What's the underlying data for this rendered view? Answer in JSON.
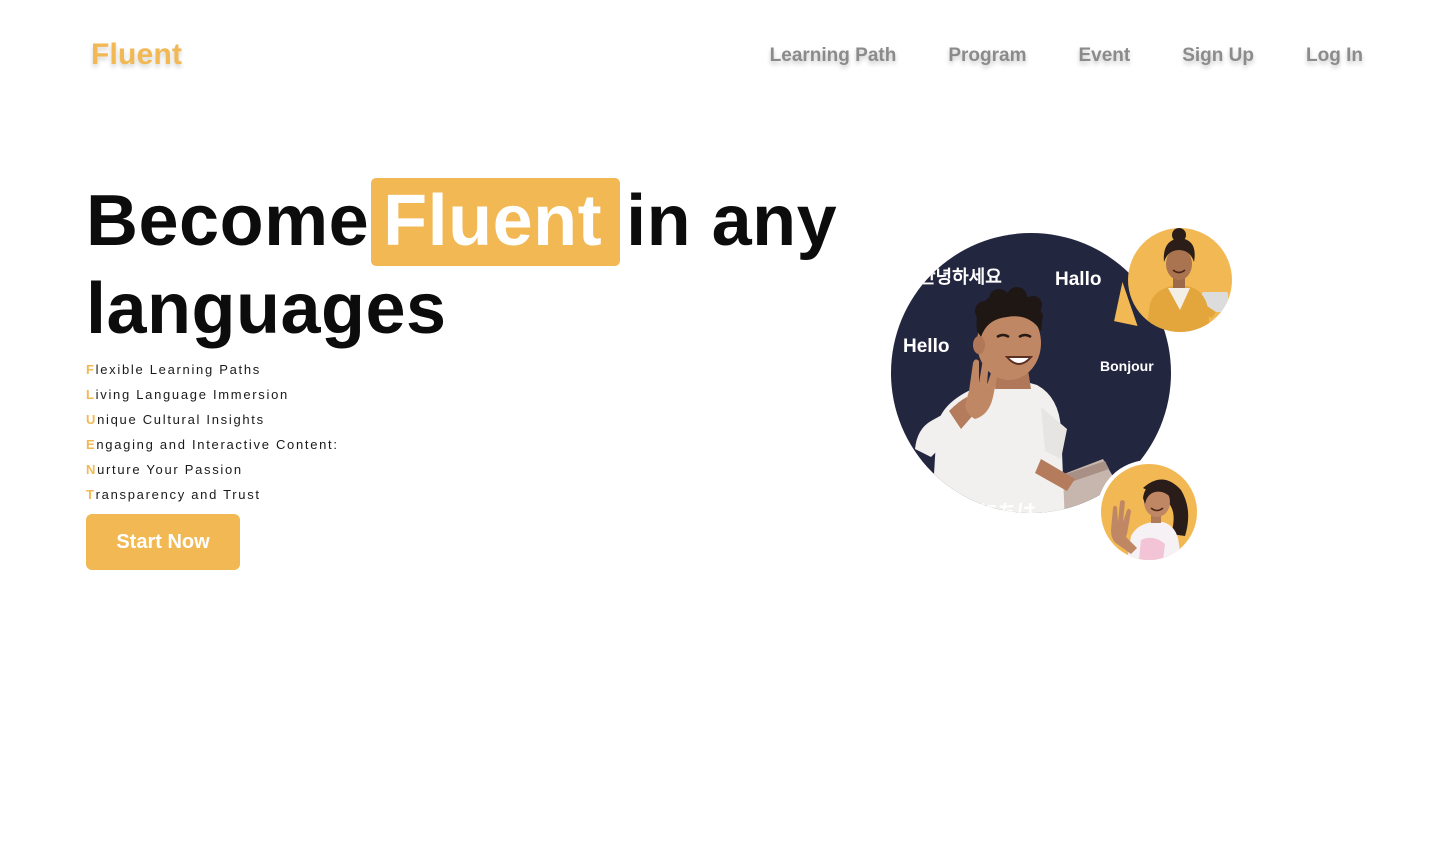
{
  "header": {
    "logo": "Fluent",
    "nav": [
      "Learning Path",
      "Program",
      "Event",
      "Sign Up",
      "Log In"
    ]
  },
  "hero": {
    "title_before": "Become",
    "title_highlight": "Fluent",
    "title_after": "in any",
    "title_line2": "languages",
    "features": [
      {
        "first": "F",
        "rest": "lexible Learning Paths"
      },
      {
        "first": "L",
        "rest": "iving Language Immersion"
      },
      {
        "first": "U",
        "rest": "nique Cultural Insights"
      },
      {
        "first": "E",
        "rest": "ngaging and Interactive Content:"
      },
      {
        "first": "N",
        "rest": "urture Your Passion"
      },
      {
        "first": "T",
        "rest": "ransparency and Trust"
      }
    ],
    "cta": "Start Now"
  },
  "illustration": {
    "greetings": [
      "안녕하세요",
      "Hallo",
      "Hello",
      "Bonjour",
      "こんにちは"
    ]
  },
  "colors": {
    "accent": "#f2b854",
    "circle": "#23263f",
    "nav_text": "#8b8b8b",
    "heading": "#0c0c0c"
  }
}
